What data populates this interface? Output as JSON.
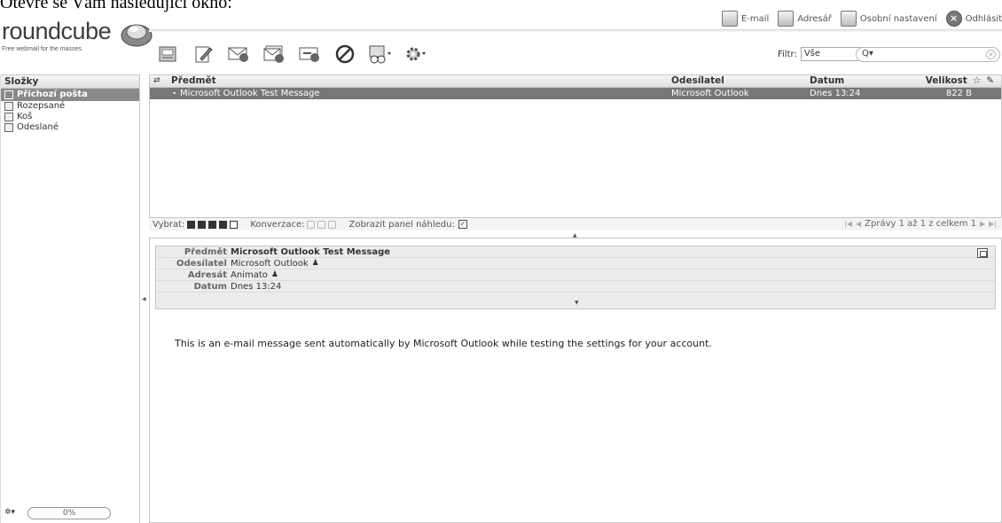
{
  "intro": "Otevře se Vám následující okno:",
  "logo": {
    "word": "roundcube",
    "tagline": "Free webmail for the masses"
  },
  "topnav": {
    "email": "E-mail",
    "addressbook": "Adresář",
    "settings": "Osobní nastavení",
    "logout": "Odhlásit"
  },
  "filter": {
    "label": "Filtr:",
    "value": "Vše"
  },
  "folders": {
    "title": "Složky",
    "items": [
      {
        "label": "Příchozí pošta",
        "icon": "inbox-icon"
      },
      {
        "label": "Rozepsané",
        "icon": "pencil-icon"
      },
      {
        "label": "Koš",
        "icon": "trash-icon"
      },
      {
        "label": "Odeslané",
        "icon": "sent-icon"
      }
    ],
    "quota": "0%"
  },
  "list": {
    "columns": {
      "subject": "Předmět",
      "from": "Odesílatel",
      "date": "Datum",
      "size": "Velikost"
    },
    "rows": [
      {
        "subject": "Microsoft Outlook Test Message",
        "from": "Microsoft Outlook",
        "date": "Dnes 13:24",
        "size": "822 B"
      }
    ]
  },
  "footer": {
    "select": "Vybrat:",
    "threads": "Konverzace:",
    "preview": "Zobrazit panel náhledu:",
    "pager": "Zprávy 1 až 1 z celkem 1"
  },
  "message": {
    "labels": {
      "subject": "Předmět",
      "from": "Odesílatel",
      "to": "Adresát",
      "date": "Datum"
    },
    "subject": "Microsoft Outlook Test Message",
    "from": "Microsoft Outlook",
    "to": "Animato",
    "date": "Dnes 13:24",
    "body": "This is an e-mail message sent automatically by Microsoft Outlook while testing the settings for your account."
  },
  "colors": {
    "selected_row": "#777777",
    "header_bg": "#ececec"
  }
}
